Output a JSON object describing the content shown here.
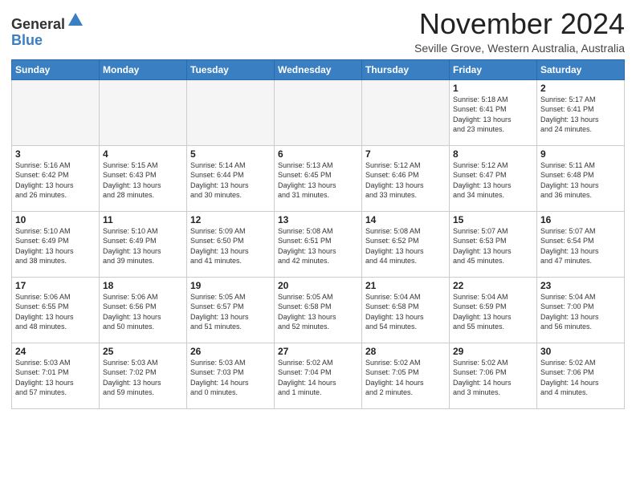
{
  "logo": {
    "general": "General",
    "blue": "Blue"
  },
  "header": {
    "month": "November 2024",
    "location": "Seville Grove, Western Australia, Australia"
  },
  "weekdays": [
    "Sunday",
    "Monday",
    "Tuesday",
    "Wednesday",
    "Thursday",
    "Friday",
    "Saturday"
  ],
  "weeks": [
    [
      {
        "day": "",
        "info": ""
      },
      {
        "day": "",
        "info": ""
      },
      {
        "day": "",
        "info": ""
      },
      {
        "day": "",
        "info": ""
      },
      {
        "day": "",
        "info": ""
      },
      {
        "day": "1",
        "info": "Sunrise: 5:18 AM\nSunset: 6:41 PM\nDaylight: 13 hours\nand 23 minutes."
      },
      {
        "day": "2",
        "info": "Sunrise: 5:17 AM\nSunset: 6:41 PM\nDaylight: 13 hours\nand 24 minutes."
      }
    ],
    [
      {
        "day": "3",
        "info": "Sunrise: 5:16 AM\nSunset: 6:42 PM\nDaylight: 13 hours\nand 26 minutes."
      },
      {
        "day": "4",
        "info": "Sunrise: 5:15 AM\nSunset: 6:43 PM\nDaylight: 13 hours\nand 28 minutes."
      },
      {
        "day": "5",
        "info": "Sunrise: 5:14 AM\nSunset: 6:44 PM\nDaylight: 13 hours\nand 30 minutes."
      },
      {
        "day": "6",
        "info": "Sunrise: 5:13 AM\nSunset: 6:45 PM\nDaylight: 13 hours\nand 31 minutes."
      },
      {
        "day": "7",
        "info": "Sunrise: 5:12 AM\nSunset: 6:46 PM\nDaylight: 13 hours\nand 33 minutes."
      },
      {
        "day": "8",
        "info": "Sunrise: 5:12 AM\nSunset: 6:47 PM\nDaylight: 13 hours\nand 34 minutes."
      },
      {
        "day": "9",
        "info": "Sunrise: 5:11 AM\nSunset: 6:48 PM\nDaylight: 13 hours\nand 36 minutes."
      }
    ],
    [
      {
        "day": "10",
        "info": "Sunrise: 5:10 AM\nSunset: 6:49 PM\nDaylight: 13 hours\nand 38 minutes."
      },
      {
        "day": "11",
        "info": "Sunrise: 5:10 AM\nSunset: 6:49 PM\nDaylight: 13 hours\nand 39 minutes."
      },
      {
        "day": "12",
        "info": "Sunrise: 5:09 AM\nSunset: 6:50 PM\nDaylight: 13 hours\nand 41 minutes."
      },
      {
        "day": "13",
        "info": "Sunrise: 5:08 AM\nSunset: 6:51 PM\nDaylight: 13 hours\nand 42 minutes."
      },
      {
        "day": "14",
        "info": "Sunrise: 5:08 AM\nSunset: 6:52 PM\nDaylight: 13 hours\nand 44 minutes."
      },
      {
        "day": "15",
        "info": "Sunrise: 5:07 AM\nSunset: 6:53 PM\nDaylight: 13 hours\nand 45 minutes."
      },
      {
        "day": "16",
        "info": "Sunrise: 5:07 AM\nSunset: 6:54 PM\nDaylight: 13 hours\nand 47 minutes."
      }
    ],
    [
      {
        "day": "17",
        "info": "Sunrise: 5:06 AM\nSunset: 6:55 PM\nDaylight: 13 hours\nand 48 minutes."
      },
      {
        "day": "18",
        "info": "Sunrise: 5:06 AM\nSunset: 6:56 PM\nDaylight: 13 hours\nand 50 minutes."
      },
      {
        "day": "19",
        "info": "Sunrise: 5:05 AM\nSunset: 6:57 PM\nDaylight: 13 hours\nand 51 minutes."
      },
      {
        "day": "20",
        "info": "Sunrise: 5:05 AM\nSunset: 6:58 PM\nDaylight: 13 hours\nand 52 minutes."
      },
      {
        "day": "21",
        "info": "Sunrise: 5:04 AM\nSunset: 6:58 PM\nDaylight: 13 hours\nand 54 minutes."
      },
      {
        "day": "22",
        "info": "Sunrise: 5:04 AM\nSunset: 6:59 PM\nDaylight: 13 hours\nand 55 minutes."
      },
      {
        "day": "23",
        "info": "Sunrise: 5:04 AM\nSunset: 7:00 PM\nDaylight: 13 hours\nand 56 minutes."
      }
    ],
    [
      {
        "day": "24",
        "info": "Sunrise: 5:03 AM\nSunset: 7:01 PM\nDaylight: 13 hours\nand 57 minutes."
      },
      {
        "day": "25",
        "info": "Sunrise: 5:03 AM\nSunset: 7:02 PM\nDaylight: 13 hours\nand 59 minutes."
      },
      {
        "day": "26",
        "info": "Sunrise: 5:03 AM\nSunset: 7:03 PM\nDaylight: 14 hours\nand 0 minutes."
      },
      {
        "day": "27",
        "info": "Sunrise: 5:02 AM\nSunset: 7:04 PM\nDaylight: 14 hours\nand 1 minute."
      },
      {
        "day": "28",
        "info": "Sunrise: 5:02 AM\nSunset: 7:05 PM\nDaylight: 14 hours\nand 2 minutes."
      },
      {
        "day": "29",
        "info": "Sunrise: 5:02 AM\nSunset: 7:06 PM\nDaylight: 14 hours\nand 3 minutes."
      },
      {
        "day": "30",
        "info": "Sunrise: 5:02 AM\nSunset: 7:06 PM\nDaylight: 14 hours\nand 4 minutes."
      }
    ]
  ]
}
